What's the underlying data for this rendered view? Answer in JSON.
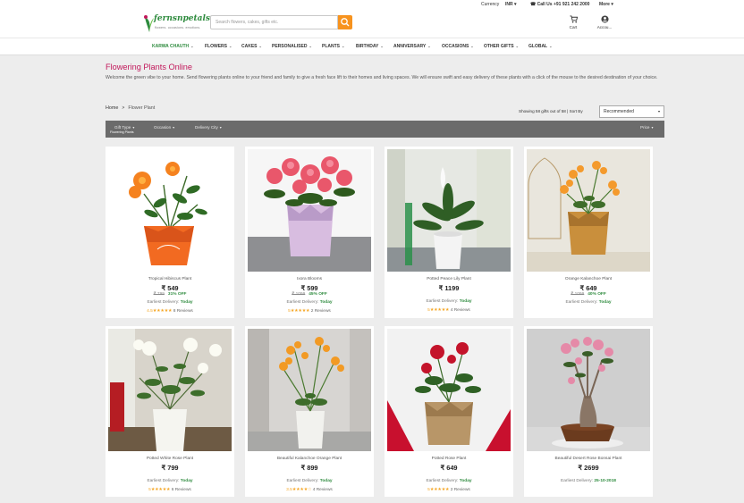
{
  "topbar": {
    "currency_label": "Currency",
    "currency_value": "INR",
    "phone": "Call Us +91 921 242 2000",
    "more": "More"
  },
  "header": {
    "logo_text": "fernsnpetals",
    "logo_tagline": "flowers. occasions. emotions.",
    "search_placeholder": "Search flowers, cakes, gifts etc.",
    "cart_label": "Cart",
    "account_label": "Accou..."
  },
  "nav": [
    {
      "label": "KARWA CHAUTH",
      "active": true
    },
    {
      "label": "FLOWERS"
    },
    {
      "label": "CAKES"
    },
    {
      "label": "PERSONALISED"
    },
    {
      "label": "PLANTS"
    },
    {
      "label": "BIRTHDAY"
    },
    {
      "label": "ANNIVERSARY"
    },
    {
      "label": "OCCASIONS"
    },
    {
      "label": "OTHER GIFTS"
    },
    {
      "label": "GLOBAL"
    }
  ],
  "page": {
    "title": "Flowering Plants Online",
    "description": "Welcome the green vibe to your home. Send flowering plants online to your friend and family to give a fresh face lift to their homes and living spaces. We will ensure swift and easy delivery of these plants with a click of the mouse to the desired destination of your choice."
  },
  "breadcrumb": {
    "home": "Home",
    "separator": ">",
    "current": "Flower Plant"
  },
  "results": {
    "showing_text": "Showing 58 gifts out of 58 | Sort By",
    "sort_value": "Recommended"
  },
  "filters": {
    "gift_type": "Gift Type",
    "gift_type_value": "Flowering Plants",
    "occasion": "Occasion",
    "delivery_city": "Delivery City",
    "price": "Price"
  },
  "products": [
    {
      "name": "Tropical Hibiscus Plant",
      "price": "₹ 549",
      "old_price": "₹ 799",
      "discount": "31% OFF",
      "delivery_label": "Earliest Delivery:",
      "delivery_value": "Today",
      "rating_value": "4.5",
      "stars": "★★★★★",
      "reviews": "8 Reviews"
    },
    {
      "name": "Ixora Blooms",
      "price": "₹ 599",
      "old_price": "₹ 1099",
      "discount": "45% OFF",
      "delivery_label": "Earliest Delivery:",
      "delivery_value": "Today",
      "rating_value": "5",
      "stars": "★★★★★",
      "reviews": "2 Reviews"
    },
    {
      "name": "Potted Peace Lily Plant",
      "price": "₹ 1199",
      "old_price": "",
      "discount": "",
      "delivery_label": "Earliest Delivery:",
      "delivery_value": "Today",
      "rating_value": "5",
      "stars": "★★★★★",
      "reviews": "4 Reviews"
    },
    {
      "name": "Orange Kalanchoe Plant",
      "price": "₹ 649",
      "old_price": "₹ 1099",
      "discount": "40% OFF",
      "delivery_label": "Earliest Delivery:",
      "delivery_value": "Today",
      "rating_value": "",
      "stars": "",
      "reviews": ""
    },
    {
      "name": "Potted White Rose Plant",
      "price": "₹ 799",
      "old_price": "",
      "discount": "",
      "delivery_label": "Earliest Delivery:",
      "delivery_value": "Today",
      "rating_value": "5",
      "stars": "★★★★★",
      "reviews": "6 Reviews"
    },
    {
      "name": "Beautiful Kalanchoe Orange Plant",
      "price": "₹ 899",
      "old_price": "",
      "discount": "",
      "delivery_label": "Earliest Delivery:",
      "delivery_value": "Today",
      "rating_value": "3.5",
      "stars": "★★★★☆",
      "reviews": "4 Reviews"
    },
    {
      "name": "Potted Rose Plant",
      "price": "₹ 649",
      "old_price": "",
      "discount": "",
      "delivery_label": "Earliest Delivery:",
      "delivery_value": "Today",
      "rating_value": "5",
      "stars": "★★★★★",
      "reviews": "2 Reviews"
    },
    {
      "name": "Beautiful Desert Rose Bonsai Plant",
      "price": "₹ 2699",
      "old_price": "",
      "discount": "",
      "delivery_label": "Earliest Delivery:",
      "delivery_value": "25-10-2018",
      "rating_value": "",
      "stars": "",
      "reviews": ""
    }
  ],
  "colors": {
    "brand_green": "#2e8b3e",
    "title_pink": "#c2185b",
    "search_orange": "#f7931e",
    "filter_bar": "#6b6b6b"
  }
}
